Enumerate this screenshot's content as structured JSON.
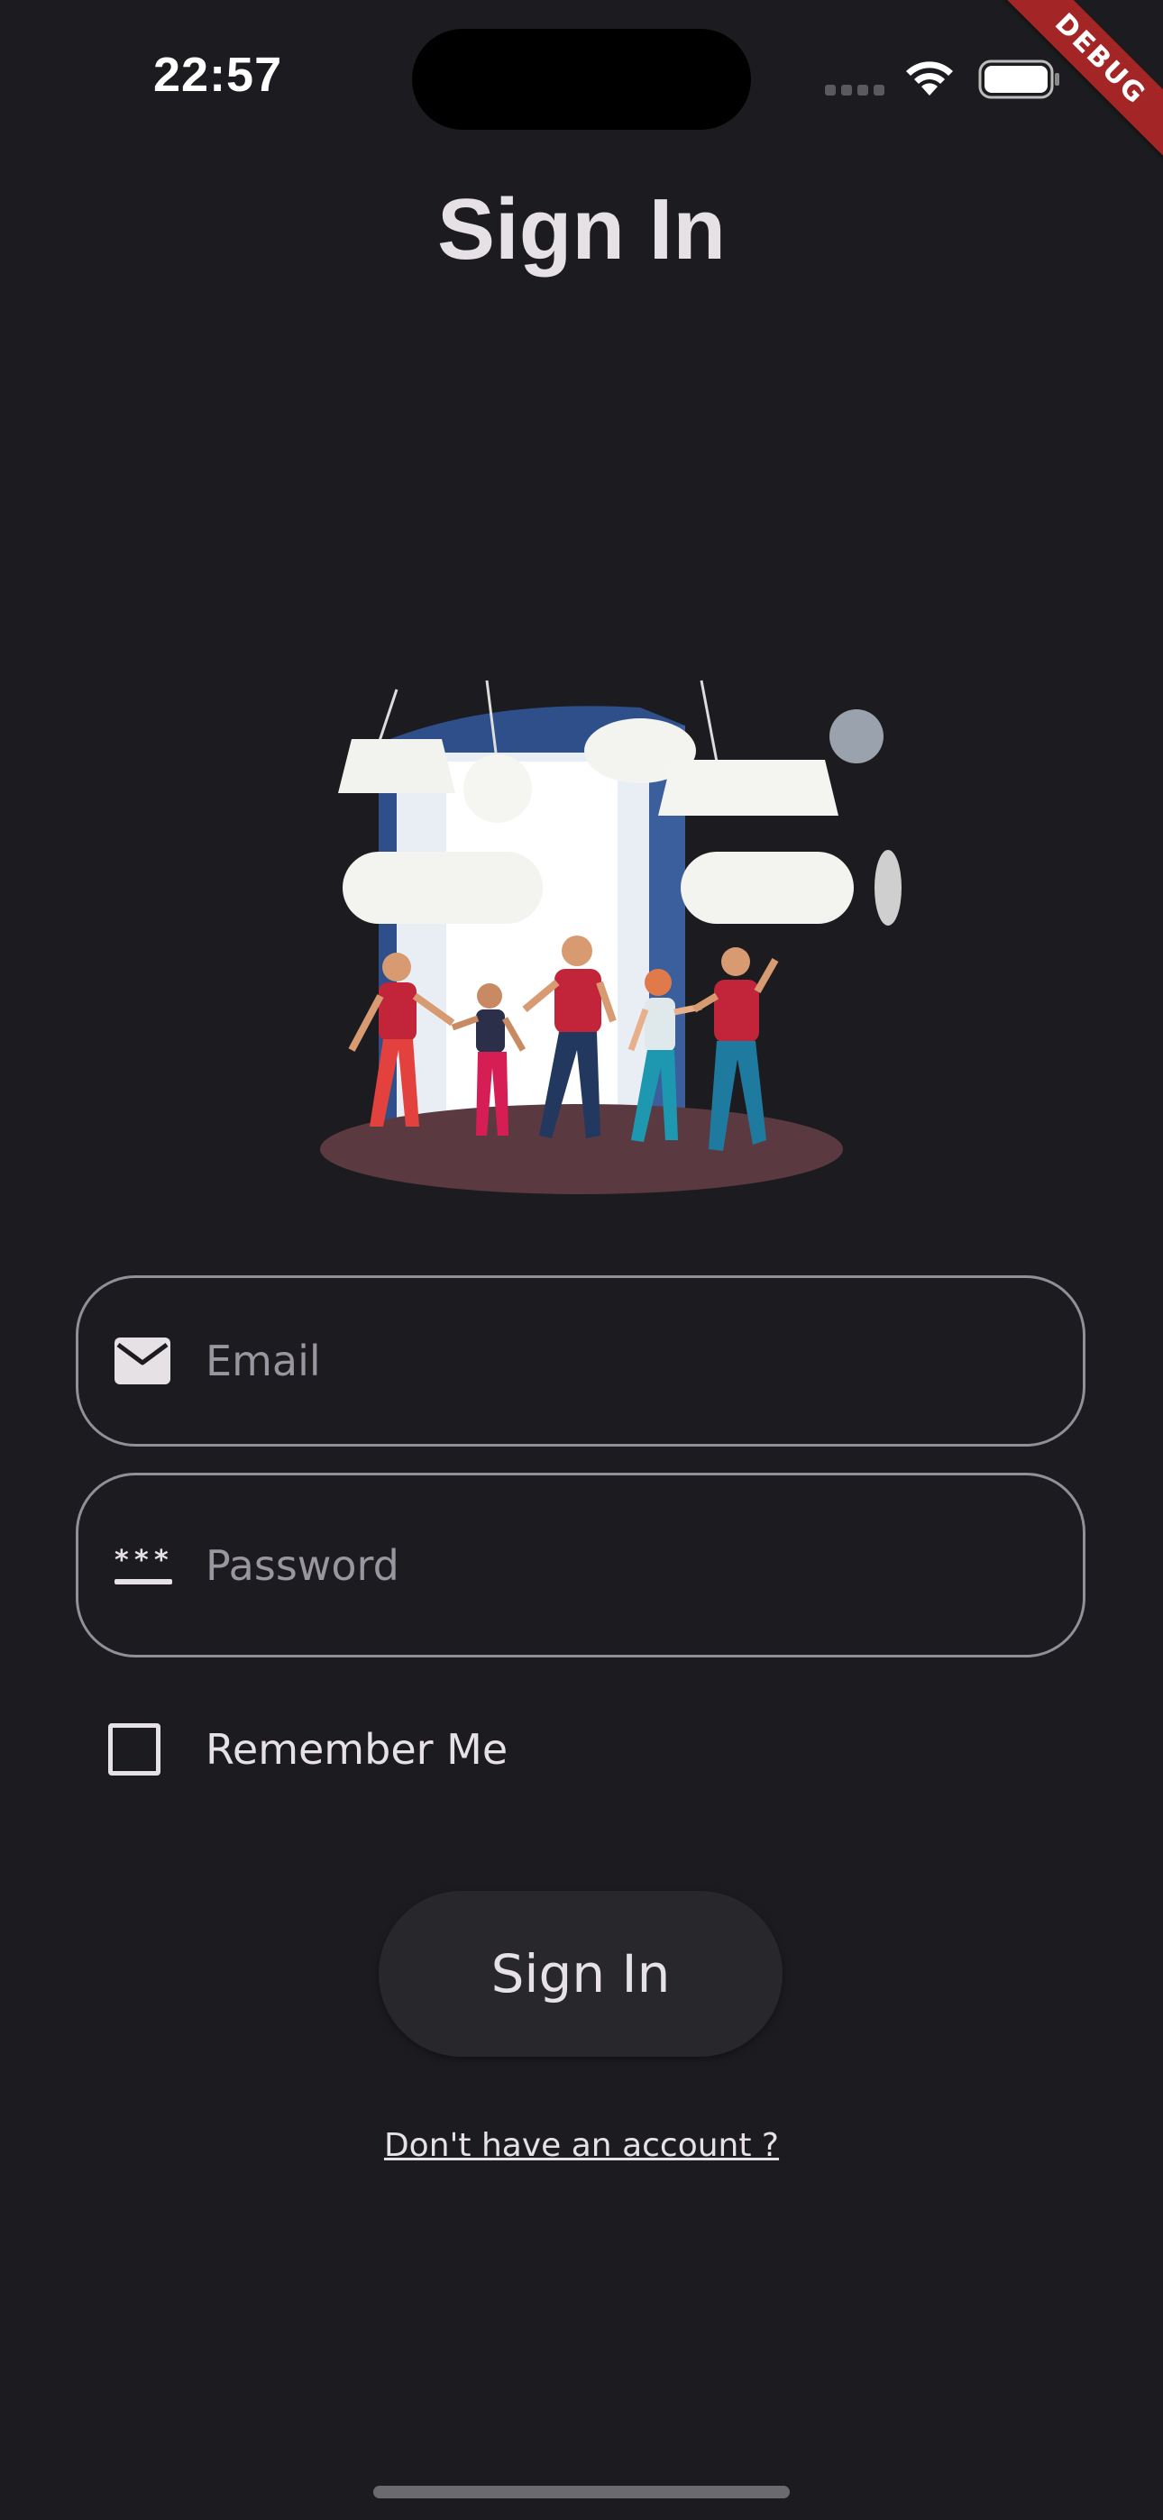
{
  "status_bar": {
    "time": "22:57"
  },
  "debug_banner": "DEBUG",
  "page": {
    "title": "Sign In"
  },
  "form": {
    "email_placeholder": "Email",
    "email_value": "",
    "email_icon": "envelope-icon",
    "password_placeholder": "Password",
    "password_value": "",
    "password_icon": "password-dots-icon",
    "remember_label": "Remember Me",
    "remember_checked": false,
    "submit_label": "Sign In",
    "signup_link": "Don't have an account ?"
  },
  "colors": {
    "background": "#1c1b1f",
    "text": "#e6e1e5",
    "outline": "#938f99",
    "button": "#28272b",
    "debug_ribbon": "#a32525"
  }
}
